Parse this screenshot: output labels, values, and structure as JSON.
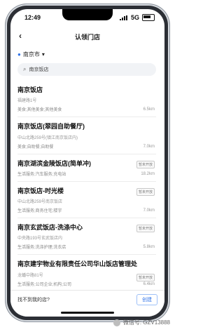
{
  "status": {
    "time": "12:49",
    "network": "5G"
  },
  "nav": {
    "title": "认领门店",
    "back_icon": "chevron-left-icon"
  },
  "city": {
    "label": "南京市",
    "dropdown": "▾"
  },
  "search": {
    "value": "南京饭店"
  },
  "stores": [
    {
      "name": "南京饭店",
      "address": "福建路1号",
      "category": "美食;其他美食;其他美食",
      "distance": "6.5km",
      "tag": ""
    },
    {
      "name": "南京饭店(翠园自助餐厅)",
      "address": "中山北路259号(镇江南京饭店内)",
      "category": "美食;自助餐;自助餐",
      "distance": "7.0km",
      "tag": ""
    },
    {
      "name": "南京湖滨金陵饭店(简单冲)",
      "address": "",
      "category": "生活服务;汽车服务;充电站",
      "distance": "18.2km",
      "tag": "暂未开放"
    },
    {
      "name": "南京饭店-时光楼",
      "address": "中山北路259号南京饭店",
      "category": "生活服务;商务住宅;楼宇",
      "distance": "7.0km",
      "tag": "暂未开放"
    },
    {
      "name": "南京玄武饭店-洗涤中心",
      "address": "中央路193号玄武饭店内",
      "category": "生活服务;洗涤护理;洗衣店",
      "distance": "5.8km",
      "tag": "暂未开放"
    },
    {
      "name": "南京建宇物业有限责任公司华山饭店管理处",
      "address": "龙蟠中路81号",
      "category": "生活服务;公司企业;机构;公司",
      "distance": "6.4km",
      "tag": "暂未开放"
    }
  ],
  "bottom": {
    "question": "找不到我的店?",
    "button": "创建"
  },
  "watermark": {
    "text": "微信号: GZV13888"
  }
}
